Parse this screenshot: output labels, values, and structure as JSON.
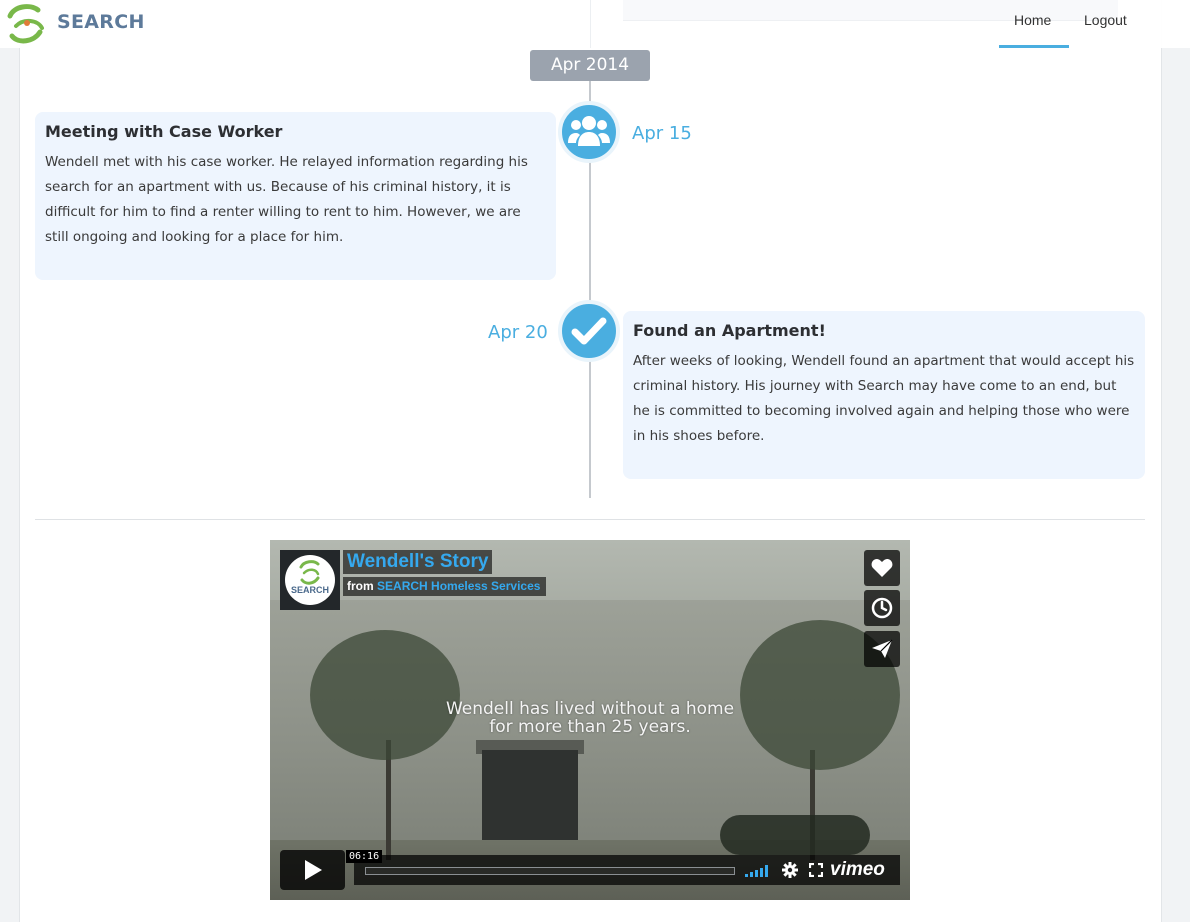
{
  "navbar": {
    "logo_text": "SEARCH",
    "links": [
      {
        "label": "Home",
        "active": true
      },
      {
        "label": "Logout",
        "active": false
      }
    ],
    "accent_color": "#4aaee0"
  },
  "timeline": {
    "period": "Apr 2014",
    "events": [
      {
        "date": "Apr 15",
        "icon": "users-group-icon",
        "title": "Meeting with Case Worker",
        "body": "Wendell met with his case worker. He relayed information regarding his search for an apartment with us. Because of his criminal history, it is difficult for him to find a renter willing to rent to him. However, we are still ongoing and looking for a place for him."
      },
      {
        "date": "Apr 20",
        "icon": "checkmark-icon",
        "title": "Found an Apartment!",
        "body": "After weeks of looking, Wendell found an apartment that would accept his criminal history. His journey with Search may have come to an end, but he is committed to becoming involved again and helping those who were in his shoes before."
      }
    ]
  },
  "video": {
    "title": "Wendell's Story",
    "from_label": "from",
    "owner": "SEARCH Homeless Services",
    "logo_text": "SEARCH",
    "caption_line1": "Wendell has lived without a home",
    "caption_line2": "for more than 25 years.",
    "duration": "06:16",
    "brand": "vimeo",
    "progress_fraction": 0.0,
    "buttons": [
      "like-icon",
      "watch-later-icon",
      "share-icon"
    ]
  }
}
